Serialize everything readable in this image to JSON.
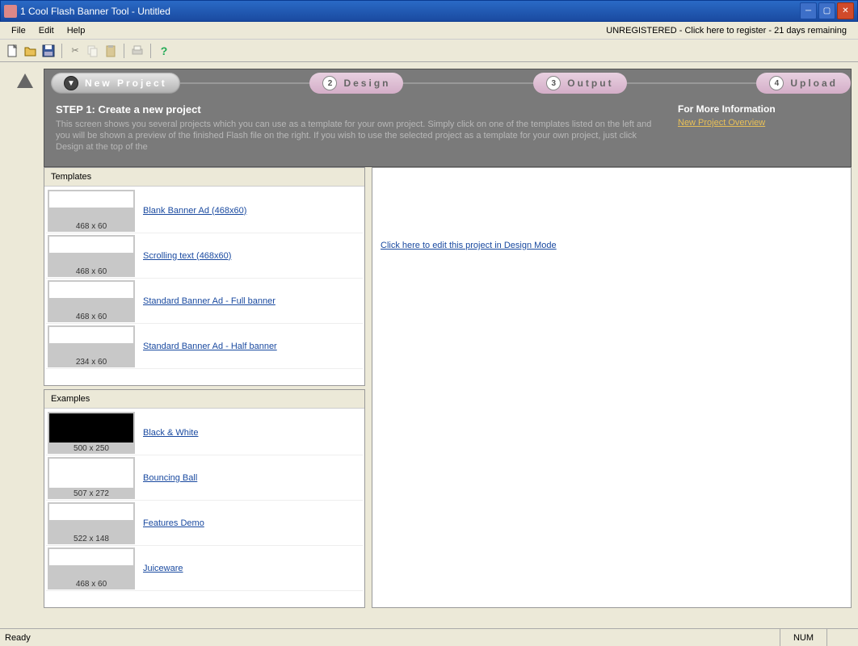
{
  "window": {
    "title": "1 Cool Flash Banner Tool - Untitled"
  },
  "menu": {
    "file": "File",
    "edit": "Edit",
    "help": "Help",
    "register": "UNREGISTERED - Click here to register - 21 days remaining"
  },
  "wizard": {
    "steps": [
      {
        "num_label": "▼",
        "label": "New Project"
      },
      {
        "num_label": "2",
        "label": "Design"
      },
      {
        "num_label": "3",
        "label": "Output"
      },
      {
        "num_label": "4",
        "label": "Upload"
      }
    ],
    "step_title": "STEP 1: Create a new project",
    "step_desc": "This screen shows you several projects which you can use as a template for your own project.  Simply click on one of the templates listed on the left and you will be shown a preview of the finished Flash file on the right.  If you wish to use the selected project as a template for your own project, just click Design at the top of the",
    "info_title": "For More Information",
    "info_link": "New Project Overview"
  },
  "templates": {
    "title": "Templates",
    "items": [
      {
        "name": "Blank Banner Ad (468x60)",
        "dim": "468 x 60",
        "style": ""
      },
      {
        "name": "Scrolling text (468x60)",
        "dim": "468 x 60",
        "style": ""
      },
      {
        "name": "Standard Banner Ad - Full banner",
        "dim": "468 x 60",
        "style": ""
      },
      {
        "name": "Standard Banner Ad - Half banner",
        "dim": "234 x 60",
        "style": ""
      }
    ]
  },
  "examples": {
    "title": "Examples",
    "items": [
      {
        "name": "Black & White",
        "dim": "500 x 250",
        "style": "black"
      },
      {
        "name": "Bouncing Ball",
        "dim": "507 x 272",
        "style": "white"
      },
      {
        "name": "Features Demo",
        "dim": "522 x 148",
        "style": ""
      },
      {
        "name": "Juiceware",
        "dim": "468 x 60",
        "style": ""
      }
    ]
  },
  "preview": {
    "design_link": "Click here to edit this project in Design Mode"
  },
  "status": {
    "ready": "Ready",
    "num": "NUM"
  }
}
